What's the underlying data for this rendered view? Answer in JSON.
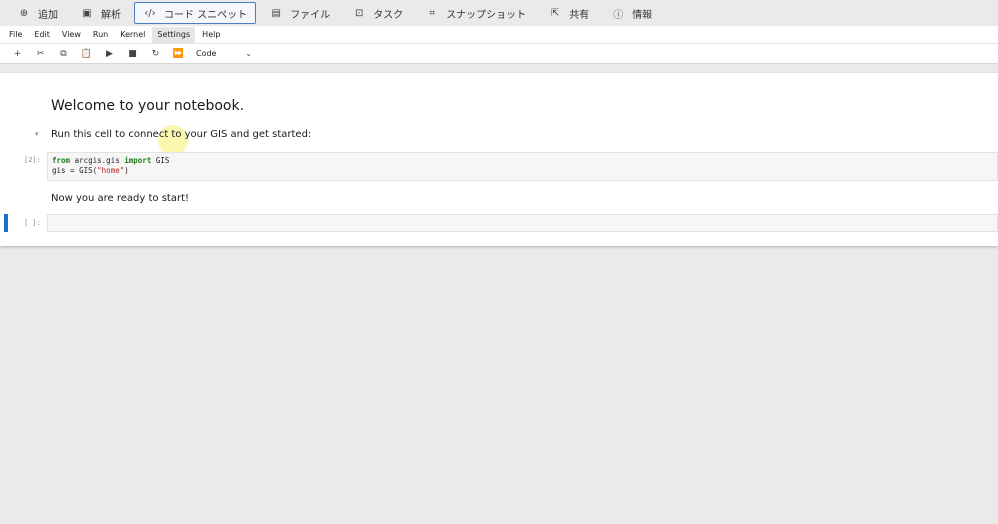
{
  "ribbon": {
    "items": [
      {
        "icon": "add-circle-icon",
        "glyph": "⊕",
        "label": "追加",
        "active": false
      },
      {
        "icon": "analysis-icon",
        "glyph": "▣",
        "label": "解析",
        "active": false
      },
      {
        "icon": "code-icon",
        "glyph": "‹/›",
        "label": "コード スニペット",
        "active": true
      },
      {
        "icon": "file-icon",
        "glyph": "▤",
        "label": "ファイル",
        "active": false
      },
      {
        "icon": "task-icon",
        "glyph": "⊡",
        "label": "タスク",
        "active": false
      },
      {
        "icon": "snapshot-icon",
        "glyph": "⌗",
        "label": "スナップショット",
        "active": false
      },
      {
        "icon": "share-icon",
        "glyph": "⇱",
        "label": "共有",
        "active": false
      },
      {
        "icon": "info-icon",
        "glyph": "ⓘ",
        "label": "情報",
        "active": false
      }
    ]
  },
  "menubar": {
    "items": [
      "File",
      "Edit",
      "View",
      "Run",
      "Kernel",
      "Settings",
      "Help"
    ]
  },
  "toolbar": {
    "buttons": [
      {
        "name": "add-cell-icon",
        "glyph": "+"
      },
      {
        "name": "cut-icon",
        "glyph": "✂"
      },
      {
        "name": "copy-icon",
        "glyph": "⧉"
      },
      {
        "name": "paste-icon",
        "glyph": "📋"
      },
      {
        "name": "run-icon",
        "glyph": "▶"
      },
      {
        "name": "stop-icon",
        "glyph": "■"
      },
      {
        "name": "restart-icon",
        "glyph": "↻"
      },
      {
        "name": "fast-forward-icon",
        "glyph": "⏩"
      }
    ],
    "cell_type": "Code"
  },
  "notebook": {
    "heading": "Welcome to your notebook.",
    "intro": "Run this cell to connect to your GIS and get started:",
    "cell1_prompt": "[2]:",
    "cell1_code": {
      "line1_kw1": "from",
      "line1_mod": " arcgis.gis ",
      "line1_kw2": "import",
      "line1_rest": " GIS",
      "line2_a": "gis = GIS(",
      "line2_str": "\"home\"",
      "line2_b": ")"
    },
    "ready": "Now you are ready to start!",
    "cell2_prompt": "[ ]:"
  }
}
